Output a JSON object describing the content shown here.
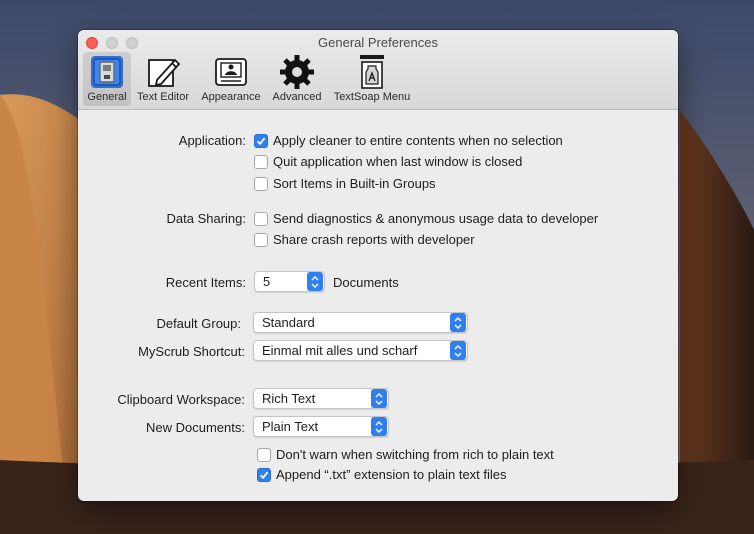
{
  "window": {
    "title": "General Preferences"
  },
  "toolbar": {
    "items": [
      {
        "label": "General",
        "icon": "switch-icon",
        "selected": true
      },
      {
        "label": "Text Editor",
        "icon": "pencil-icon"
      },
      {
        "label": "Appearance",
        "icon": "appearance-icon"
      },
      {
        "label": "Advanced",
        "icon": "gear-icon"
      },
      {
        "label": "TextSoap Menu",
        "icon": "menu-bar-icon"
      }
    ]
  },
  "application": {
    "label": "Application:",
    "options": [
      {
        "label": "Apply cleaner to entire contents when no selection",
        "checked": true
      },
      {
        "label": "Quit application when last window is closed",
        "checked": false
      },
      {
        "label": "Sort Items in Built-in Groups",
        "checked": false
      }
    ]
  },
  "data_sharing": {
    "label": "Data Sharing:",
    "options": [
      {
        "label": "Send diagnostics & anonymous usage data to developer",
        "checked": false
      },
      {
        "label": "Share crash reports with developer",
        "checked": false
      }
    ]
  },
  "recent_items": {
    "label": "Recent Items:",
    "value": "5",
    "suffix": "Documents"
  },
  "default_group": {
    "label": "Default Group:",
    "value": "Standard"
  },
  "myscrub_shortcut": {
    "label": "MyScrub Shortcut:",
    "value": "Einmal mit alles und scharf"
  },
  "clipboard_workspace": {
    "label": "Clipboard Workspace:",
    "value": "Rich Text"
  },
  "new_documents": {
    "label": "New Documents:",
    "value": "Plain Text",
    "options": [
      {
        "label": "Don't warn when switching from rich to plain text",
        "checked": false
      },
      {
        "label": "Append “.txt” extension to plain text files",
        "checked": true
      }
    ]
  },
  "colors": {
    "accent": "#2f80ed",
    "close": "#fd5f57"
  }
}
